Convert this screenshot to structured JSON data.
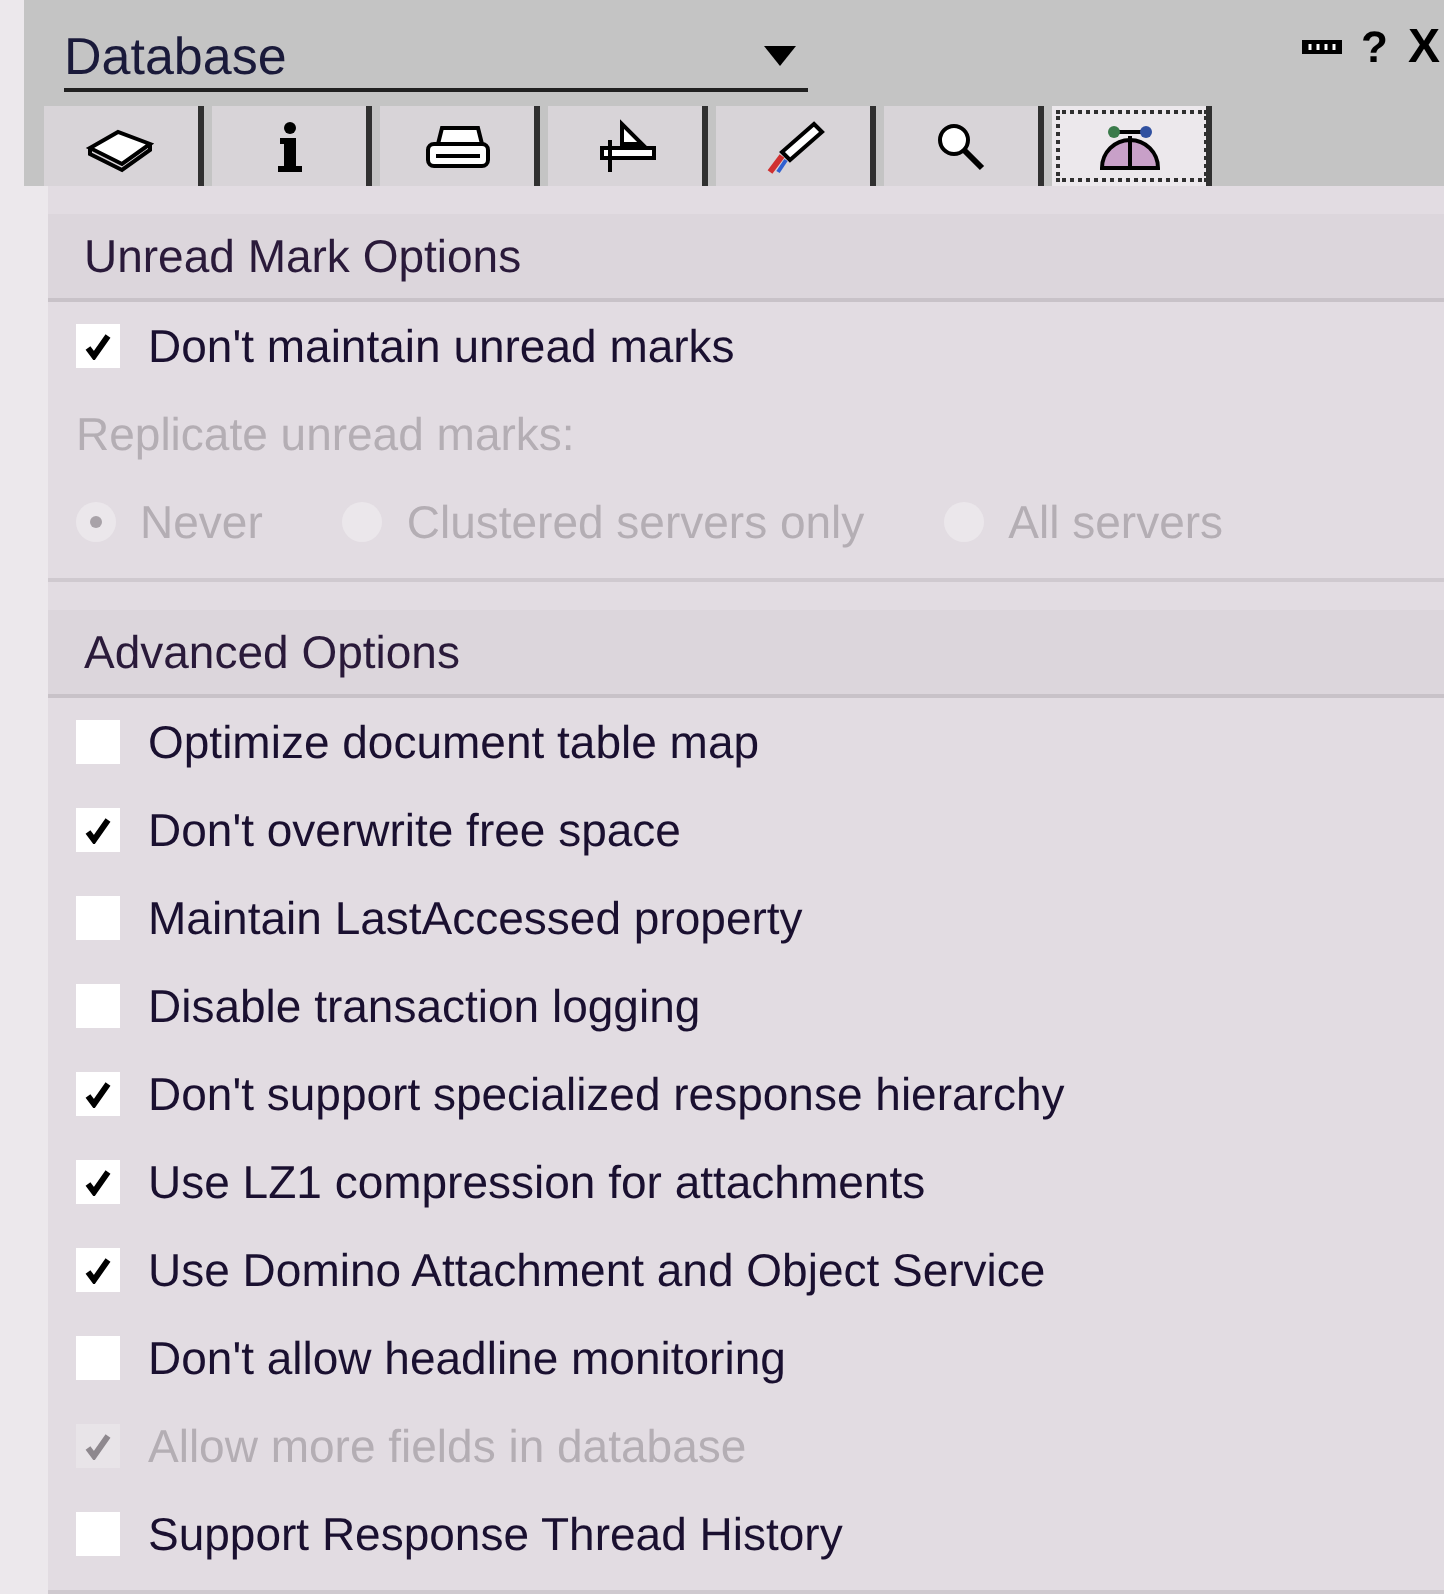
{
  "header": {
    "title": "Database",
    "help": "?",
    "close": "X"
  },
  "tabs": [
    {
      "selected": false
    },
    {
      "selected": false
    },
    {
      "selected": false
    },
    {
      "selected": false
    },
    {
      "selected": false
    },
    {
      "selected": false
    },
    {
      "selected": true
    }
  ],
  "sections": [
    {
      "title": "Unread Mark Options",
      "items": [
        {
          "kind": "checkbox",
          "label": "Don't maintain unread marks",
          "checked": true,
          "disabled": false
        },
        {
          "kind": "label",
          "label": "Replicate unread marks:",
          "disabled": true
        },
        {
          "kind": "radios",
          "disabled": true,
          "options": [
            {
              "label": "Never",
              "selected": true
            },
            {
              "label": "Clustered servers only",
              "selected": false
            },
            {
              "label": "All servers",
              "selected": false
            }
          ]
        }
      ]
    },
    {
      "title": "Advanced Options",
      "items": [
        {
          "kind": "checkbox",
          "label": "Optimize document table map",
          "checked": false,
          "disabled": false
        },
        {
          "kind": "checkbox",
          "label": "Don't overwrite free space",
          "checked": true,
          "disabled": false
        },
        {
          "kind": "checkbox",
          "label": "Maintain LastAccessed property",
          "checked": false,
          "disabled": false
        },
        {
          "kind": "checkbox",
          "label": "Disable transaction logging",
          "checked": false,
          "disabled": false
        },
        {
          "kind": "checkbox",
          "label": "Don't support specialized response hierarchy",
          "checked": true,
          "disabled": false
        },
        {
          "kind": "checkbox",
          "label": "Use LZ1 compression for attachments",
          "checked": true,
          "disabled": false
        },
        {
          "kind": "checkbox",
          "label": "Use Domino Attachment and Object Service",
          "checked": true,
          "disabled": false
        },
        {
          "kind": "checkbox",
          "label": "Don't allow headline monitoring",
          "checked": false,
          "disabled": false
        },
        {
          "kind": "checkbox",
          "label": "Allow more fields in database",
          "checked": true,
          "disabled": true
        },
        {
          "kind": "checkbox",
          "label": "Support Response Thread History",
          "checked": false,
          "disabled": false
        }
      ]
    }
  ]
}
